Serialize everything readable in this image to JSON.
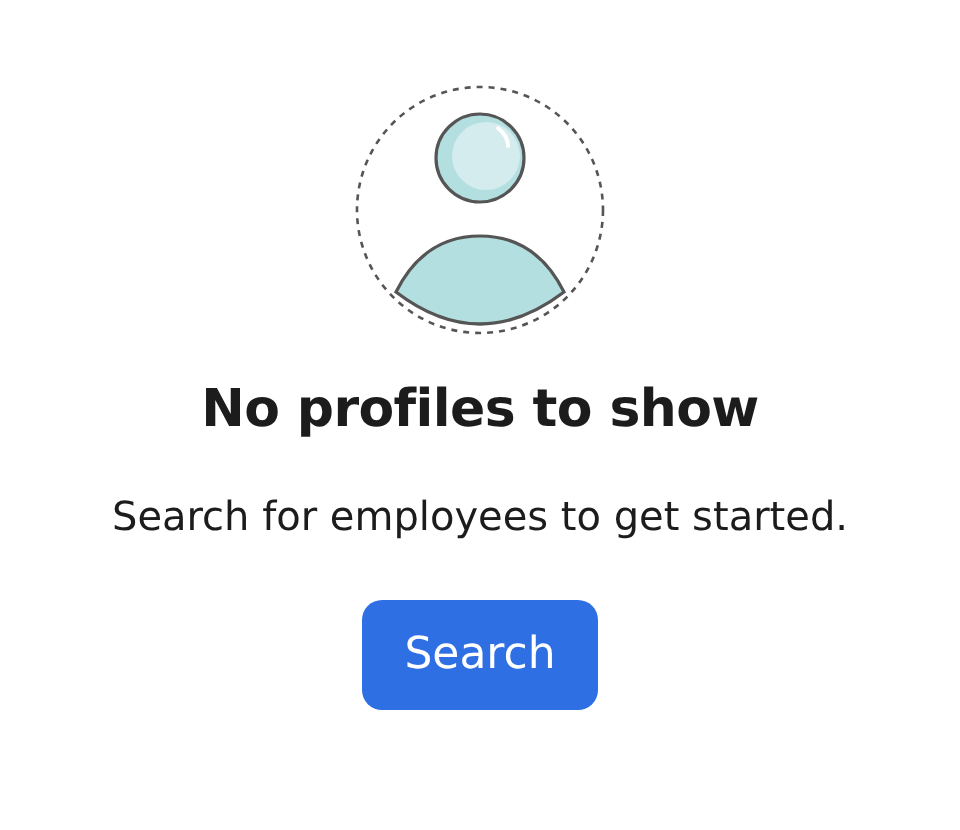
{
  "empty_state": {
    "title": "No profiles to show",
    "message": "Search for employees to get started.",
    "button": "Search"
  }
}
